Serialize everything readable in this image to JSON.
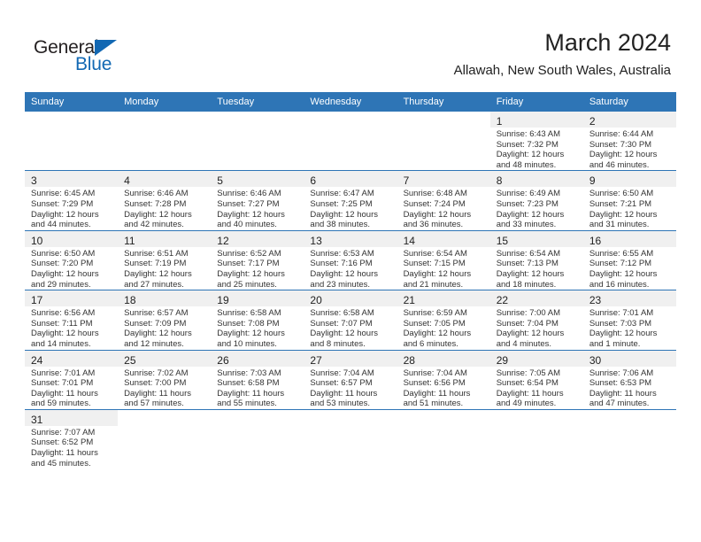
{
  "brand": {
    "name_part1": "General",
    "name_part2": "Blue",
    "triangle_color": "#1268b3"
  },
  "header": {
    "month_title": "March 2024",
    "location": "Allawah, New South Wales, Australia"
  },
  "theme": {
    "header_bg": "#2e75b6",
    "header_text": "#ffffff",
    "daynum_band": "#f0f0f0",
    "grid_line": "#2e75b6",
    "body_text": "#333333"
  },
  "calendar": {
    "weekday_headers": [
      "Sunday",
      "Monday",
      "Tuesday",
      "Wednesday",
      "Thursday",
      "Friday",
      "Saturday"
    ],
    "weeks": [
      [
        {
          "day": "",
          "blank": true,
          "sunrise": "",
          "sunset": "",
          "daylight_line1": "",
          "daylight_line2": ""
        },
        {
          "day": "",
          "blank": true,
          "sunrise": "",
          "sunset": "",
          "daylight_line1": "",
          "daylight_line2": ""
        },
        {
          "day": "",
          "blank": true,
          "sunrise": "",
          "sunset": "",
          "daylight_line1": "",
          "daylight_line2": ""
        },
        {
          "day": "",
          "blank": true,
          "sunrise": "",
          "sunset": "",
          "daylight_line1": "",
          "daylight_line2": ""
        },
        {
          "day": "",
          "blank": true,
          "sunrise": "",
          "sunset": "",
          "daylight_line1": "",
          "daylight_line2": ""
        },
        {
          "day": "1",
          "sunrise": "Sunrise: 6:43 AM",
          "sunset": "Sunset: 7:32 PM",
          "daylight_line1": "Daylight: 12 hours",
          "daylight_line2": "and 48 minutes."
        },
        {
          "day": "2",
          "sunrise": "Sunrise: 6:44 AM",
          "sunset": "Sunset: 7:30 PM",
          "daylight_line1": "Daylight: 12 hours",
          "daylight_line2": "and 46 minutes."
        }
      ],
      [
        {
          "day": "3",
          "sunrise": "Sunrise: 6:45 AM",
          "sunset": "Sunset: 7:29 PM",
          "daylight_line1": "Daylight: 12 hours",
          "daylight_line2": "and 44 minutes."
        },
        {
          "day": "4",
          "sunrise": "Sunrise: 6:46 AM",
          "sunset": "Sunset: 7:28 PM",
          "daylight_line1": "Daylight: 12 hours",
          "daylight_line2": "and 42 minutes."
        },
        {
          "day": "5",
          "sunrise": "Sunrise: 6:46 AM",
          "sunset": "Sunset: 7:27 PM",
          "daylight_line1": "Daylight: 12 hours",
          "daylight_line2": "and 40 minutes."
        },
        {
          "day": "6",
          "sunrise": "Sunrise: 6:47 AM",
          "sunset": "Sunset: 7:25 PM",
          "daylight_line1": "Daylight: 12 hours",
          "daylight_line2": "and 38 minutes."
        },
        {
          "day": "7",
          "sunrise": "Sunrise: 6:48 AM",
          "sunset": "Sunset: 7:24 PM",
          "daylight_line1": "Daylight: 12 hours",
          "daylight_line2": "and 36 minutes."
        },
        {
          "day": "8",
          "sunrise": "Sunrise: 6:49 AM",
          "sunset": "Sunset: 7:23 PM",
          "daylight_line1": "Daylight: 12 hours",
          "daylight_line2": "and 33 minutes."
        },
        {
          "day": "9",
          "sunrise": "Sunrise: 6:50 AM",
          "sunset": "Sunset: 7:21 PM",
          "daylight_line1": "Daylight: 12 hours",
          "daylight_line2": "and 31 minutes."
        }
      ],
      [
        {
          "day": "10",
          "sunrise": "Sunrise: 6:50 AM",
          "sunset": "Sunset: 7:20 PM",
          "daylight_line1": "Daylight: 12 hours",
          "daylight_line2": "and 29 minutes."
        },
        {
          "day": "11",
          "sunrise": "Sunrise: 6:51 AM",
          "sunset": "Sunset: 7:19 PM",
          "daylight_line1": "Daylight: 12 hours",
          "daylight_line2": "and 27 minutes."
        },
        {
          "day": "12",
          "sunrise": "Sunrise: 6:52 AM",
          "sunset": "Sunset: 7:17 PM",
          "daylight_line1": "Daylight: 12 hours",
          "daylight_line2": "and 25 minutes."
        },
        {
          "day": "13",
          "sunrise": "Sunrise: 6:53 AM",
          "sunset": "Sunset: 7:16 PM",
          "daylight_line1": "Daylight: 12 hours",
          "daylight_line2": "and 23 minutes."
        },
        {
          "day": "14",
          "sunrise": "Sunrise: 6:54 AM",
          "sunset": "Sunset: 7:15 PM",
          "daylight_line1": "Daylight: 12 hours",
          "daylight_line2": "and 21 minutes."
        },
        {
          "day": "15",
          "sunrise": "Sunrise: 6:54 AM",
          "sunset": "Sunset: 7:13 PM",
          "daylight_line1": "Daylight: 12 hours",
          "daylight_line2": "and 18 minutes."
        },
        {
          "day": "16",
          "sunrise": "Sunrise: 6:55 AM",
          "sunset": "Sunset: 7:12 PM",
          "daylight_line1": "Daylight: 12 hours",
          "daylight_line2": "and 16 minutes."
        }
      ],
      [
        {
          "day": "17",
          "sunrise": "Sunrise: 6:56 AM",
          "sunset": "Sunset: 7:11 PM",
          "daylight_line1": "Daylight: 12 hours",
          "daylight_line2": "and 14 minutes."
        },
        {
          "day": "18",
          "sunrise": "Sunrise: 6:57 AM",
          "sunset": "Sunset: 7:09 PM",
          "daylight_line1": "Daylight: 12 hours",
          "daylight_line2": "and 12 minutes."
        },
        {
          "day": "19",
          "sunrise": "Sunrise: 6:58 AM",
          "sunset": "Sunset: 7:08 PM",
          "daylight_line1": "Daylight: 12 hours",
          "daylight_line2": "and 10 minutes."
        },
        {
          "day": "20",
          "sunrise": "Sunrise: 6:58 AM",
          "sunset": "Sunset: 7:07 PM",
          "daylight_line1": "Daylight: 12 hours",
          "daylight_line2": "and 8 minutes."
        },
        {
          "day": "21",
          "sunrise": "Sunrise: 6:59 AM",
          "sunset": "Sunset: 7:05 PM",
          "daylight_line1": "Daylight: 12 hours",
          "daylight_line2": "and 6 minutes."
        },
        {
          "day": "22",
          "sunrise": "Sunrise: 7:00 AM",
          "sunset": "Sunset: 7:04 PM",
          "daylight_line1": "Daylight: 12 hours",
          "daylight_line2": "and 4 minutes."
        },
        {
          "day": "23",
          "sunrise": "Sunrise: 7:01 AM",
          "sunset": "Sunset: 7:03 PM",
          "daylight_line1": "Daylight: 12 hours",
          "daylight_line2": "and 1 minute."
        }
      ],
      [
        {
          "day": "24",
          "sunrise": "Sunrise: 7:01 AM",
          "sunset": "Sunset: 7:01 PM",
          "daylight_line1": "Daylight: 11 hours",
          "daylight_line2": "and 59 minutes."
        },
        {
          "day": "25",
          "sunrise": "Sunrise: 7:02 AM",
          "sunset": "Sunset: 7:00 PM",
          "daylight_line1": "Daylight: 11 hours",
          "daylight_line2": "and 57 minutes."
        },
        {
          "day": "26",
          "sunrise": "Sunrise: 7:03 AM",
          "sunset": "Sunset: 6:58 PM",
          "daylight_line1": "Daylight: 11 hours",
          "daylight_line2": "and 55 minutes."
        },
        {
          "day": "27",
          "sunrise": "Sunrise: 7:04 AM",
          "sunset": "Sunset: 6:57 PM",
          "daylight_line1": "Daylight: 11 hours",
          "daylight_line2": "and 53 minutes."
        },
        {
          "day": "28",
          "sunrise": "Sunrise: 7:04 AM",
          "sunset": "Sunset: 6:56 PM",
          "daylight_line1": "Daylight: 11 hours",
          "daylight_line2": "and 51 minutes."
        },
        {
          "day": "29",
          "sunrise": "Sunrise: 7:05 AM",
          "sunset": "Sunset: 6:54 PM",
          "daylight_line1": "Daylight: 11 hours",
          "daylight_line2": "and 49 minutes."
        },
        {
          "day": "30",
          "sunrise": "Sunrise: 7:06 AM",
          "sunset": "Sunset: 6:53 PM",
          "daylight_line1": "Daylight: 11 hours",
          "daylight_line2": "and 47 minutes."
        }
      ],
      [
        {
          "day": "31",
          "sunrise": "Sunrise: 7:07 AM",
          "sunset": "Sunset: 6:52 PM",
          "daylight_line1": "Daylight: 11 hours",
          "daylight_line2": "and 45 minutes."
        },
        {
          "day": "",
          "blank": true,
          "sunrise": "",
          "sunset": "",
          "daylight_line1": "",
          "daylight_line2": ""
        },
        {
          "day": "",
          "blank": true,
          "sunrise": "",
          "sunset": "",
          "daylight_line1": "",
          "daylight_line2": ""
        },
        {
          "day": "",
          "blank": true,
          "sunrise": "",
          "sunset": "",
          "daylight_line1": "",
          "daylight_line2": ""
        },
        {
          "day": "",
          "blank": true,
          "sunrise": "",
          "sunset": "",
          "daylight_line1": "",
          "daylight_line2": ""
        },
        {
          "day": "",
          "blank": true,
          "sunrise": "",
          "sunset": "",
          "daylight_line1": "",
          "daylight_line2": ""
        },
        {
          "day": "",
          "blank": true,
          "sunrise": "",
          "sunset": "",
          "daylight_line1": "",
          "daylight_line2": ""
        }
      ]
    ]
  }
}
